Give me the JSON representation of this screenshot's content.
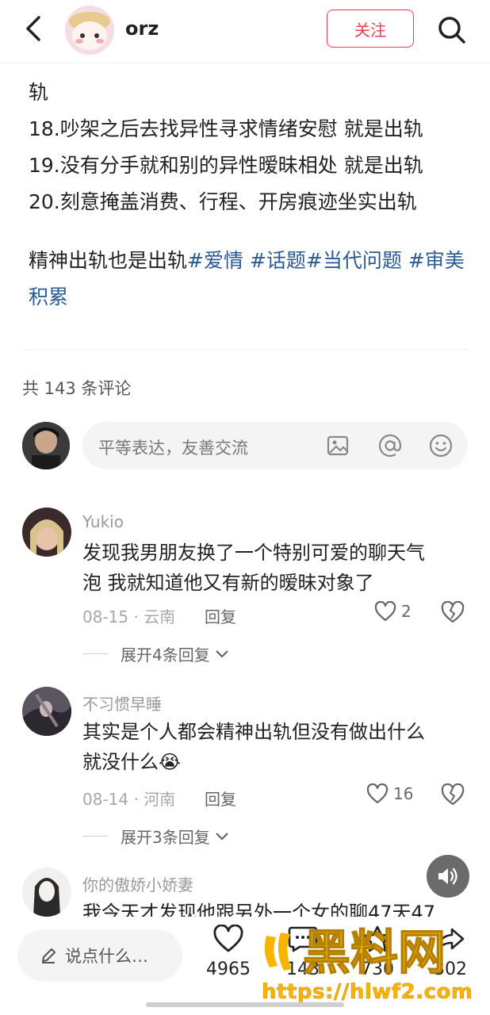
{
  "header": {
    "author_name": "orz",
    "follow_label": "关注"
  },
  "post": {
    "lines": [
      "轨",
      "18.吵架之后去找异性寻求情绪安慰 就是出轨",
      "19.没有分手就和别的异性暧昧相处 就是出轨",
      "20.刻意掩盖消费、行程、开房痕迹坐实出轨"
    ],
    "closing_text": "精神出轨也是出轨",
    "tags": [
      "#爱情",
      "#话题",
      "#当代问题",
      "#审美积累"
    ]
  },
  "comments_section": {
    "count_label": "共 143 条评论",
    "input_placeholder": "平等表达，友善交流",
    "input_icons": [
      "image-icon",
      "mention-icon",
      "emoji-icon"
    ],
    "comments": [
      {
        "user": "Yukio",
        "text_line1": "发现我男朋友换了一个特别可爱的聊天气",
        "text_line2": "泡 我就知道他又有新的暧昧对象了",
        "meta": "08-15 · 云南",
        "reply_label": "回复",
        "likes": "2",
        "expand_label": "展开4条回复"
      },
      {
        "user": "不习惯早睡",
        "text_line1": "其实是个人都会精神出轨但没有做出什么",
        "text_line2": "就没什么",
        "emoji": "😭",
        "meta": "08-14 · 河南",
        "reply_label": "回复",
        "likes": "16",
        "expand_label": "展开3条回复"
      },
      {
        "user": "你的傲娇小娇妻",
        "text_line1": "我今天才发现他跟另外一个女的聊47天47"
      }
    ]
  },
  "bottom_bar": {
    "say_placeholder": "说点什么…",
    "likes": "4965",
    "comments": "143",
    "collects": "730",
    "shares": "302"
  },
  "watermark": {
    "brand": "黑料网",
    "url": "https://hlwf2.com"
  },
  "colors": {
    "accent_red": "#ef3b54",
    "tag_blue": "#2b5a93",
    "watermark_yellow": "#f7b500"
  }
}
